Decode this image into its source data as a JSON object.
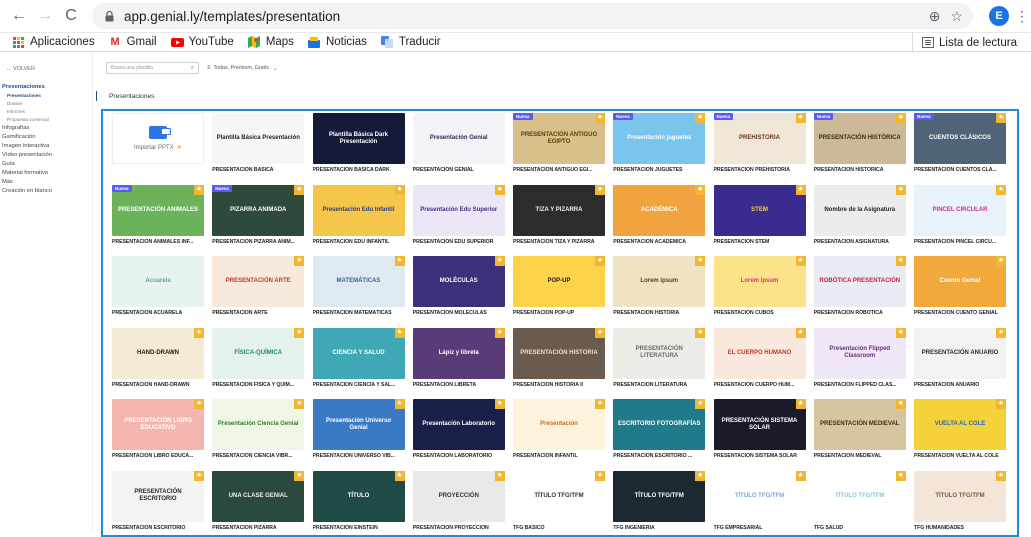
{
  "browser": {
    "url": "app.genial.ly/templates/presentation",
    "avatar_letter": "E",
    "back": "←",
    "forward": "→",
    "reload": "C",
    "zoom_icon": "⊕",
    "star_icon": "☆",
    "menu_icon": "⋮",
    "bookmarks": [
      {
        "label": "Aplicaciones",
        "icon": "apps-grid-icon"
      },
      {
        "label": "Gmail",
        "icon": "gmail-icon",
        "color": "#d93025"
      },
      {
        "label": "YouTube",
        "icon": "youtube-icon",
        "color": "#ff0000"
      },
      {
        "label": "Maps",
        "icon": "maps-icon",
        "color": "#34a853"
      },
      {
        "label": "Noticias",
        "icon": "news-icon",
        "color": "#1a73e8"
      },
      {
        "label": "Traducir",
        "icon": "translate-icon",
        "color": "#4285f4"
      }
    ],
    "reading_list": "Lista de lectura"
  },
  "sidebar": {
    "back_label": "← VOLVER",
    "items": [
      {
        "label": "Presentaciones",
        "type": "item",
        "active": true
      },
      {
        "label": "Presentaciones",
        "type": "sub",
        "active": true
      },
      {
        "label": "Dossier",
        "type": "sub"
      },
      {
        "label": "Informes",
        "type": "sub"
      },
      {
        "label": "Propuesta comercial",
        "type": "sub"
      },
      {
        "label": "Infografías",
        "type": "item"
      },
      {
        "label": "Gamificación",
        "type": "item"
      },
      {
        "label": "Imagen interactiva",
        "type": "item"
      },
      {
        "label": "Vídeo presentación",
        "type": "item"
      },
      {
        "label": "Guía",
        "type": "item"
      },
      {
        "label": "Material formativo",
        "type": "item"
      },
      {
        "label": "Más",
        "type": "item"
      },
      {
        "label": "Creación en blanco",
        "type": "item"
      }
    ]
  },
  "toolbar": {
    "search_placeholder": "Busca una plantilla",
    "filter_label": "Todas, Premium, Gratis"
  },
  "section_title": "Presentaciones",
  "import": {
    "label": "Importar PPTX",
    "star": "★",
    "badge": "BETA"
  },
  "templates": [
    {
      "label": "PRESENTACIÓN BÁSICA",
      "thumb": "Plantilla Básica Presentación",
      "bg": "#f6f6f6",
      "fg": "#222"
    },
    {
      "label": "PRESENTACIÓN BÁSICA DARK",
      "thumb": "Plantilla Básica Dark Presentación",
      "bg": "#161a3a",
      "fg": "#ffffff"
    },
    {
      "label": "PRESENTACIÓN GENIAL",
      "thumb": "Presentación Genial",
      "bg": "#f3f3f7",
      "fg": "#2a2a55"
    },
    {
      "label": "PRESENTACIÓN ANTIGUO EGI...",
      "thumb": "PRESENTACIÓN ANTIGUO EGIPTO",
      "bg": "#d9c08a",
      "fg": "#5a3a10",
      "new": true,
      "star": true
    },
    {
      "label": "PRESENTACIÓN JUGUETES",
      "thumb": "Presentación juguetes",
      "bg": "#7ac5ee",
      "fg": "#ffffff",
      "new": true,
      "star": true
    },
    {
      "label": "PRESENTACIÓN PREHISTORIA",
      "thumb": "PREHISTORIA",
      "bg": "#efe6d8",
      "fg": "#6b3a1e",
      "new": true,
      "star": true
    },
    {
      "label": "PRESENTACIÓN HISTÓRICA",
      "thumb": "PRESENTACIÓN HISTÓRICA",
      "bg": "#cdb897",
      "fg": "#3d2a14",
      "new": true,
      "star": true
    },
    {
      "label": "PRESENTACIÓN CUENTOS CLÁ...",
      "thumb": "CUENTOS CLÁSICOS",
      "bg": "#4f6577",
      "fg": "#ffffff",
      "new": true,
      "star": true
    },
    {
      "label": "PRESENTACIÓN ANIMALES INF...",
      "thumb": "PRESENTACIÓN ANIMALES",
      "bg": "#6bb25a",
      "fg": "#ffffff",
      "new": true,
      "star": true
    },
    {
      "label": "PRESENTACIÓN PIZARRA ANIM...",
      "thumb": "PIZARRA ANIMADA",
      "bg": "#2f4a3a",
      "fg": "#ffffff",
      "new": true,
      "star": true
    },
    {
      "label": "PRESENTACIÓN EDU INFANTIL",
      "thumb": "Presentación Edu Infantil",
      "bg": "#f4c64a",
      "fg": "#2a3c8a",
      "star": true
    },
    {
      "label": "PRESENTACIÓN EDU SUPERIOR",
      "thumb": "Presentación Edu Superior",
      "bg": "#ece6f6",
      "fg": "#4a2a88",
      "star": true
    },
    {
      "label": "PRESENTACIÓN TIZA Y PIZARRA",
      "thumb": "TIZA Y PIZARRA",
      "bg": "#2c2c2c",
      "fg": "#f0f0f0",
      "star": true
    },
    {
      "label": "PRESENTACIÓN ACADÉMICA",
      "thumb": "ACADÉMICA",
      "bg": "#f1a340",
      "fg": "#ffffff",
      "star": true
    },
    {
      "label": "PRESENTACIÓN STEM",
      "thumb": "STEM",
      "bg": "#3a2b8f",
      "fg": "#ffd23f",
      "star": true
    },
    {
      "label": "PRESENTACIÓN ASIGNATURA",
      "thumb": "Nombre de la Asignatura",
      "bg": "#ececec",
      "fg": "#222",
      "star": true
    },
    {
      "label": "PRESENTACIÓN PINCEL CIRCU...",
      "thumb": "PINCEL CIRCULAR",
      "bg": "#e8f2fb",
      "fg": "#d82a8e",
      "star": true
    },
    {
      "label": "PRESENTACIÓN ACUARELA",
      "thumb": "Acuarela",
      "bg": "#e6f3f1",
      "fg": "#6aa0a0"
    },
    {
      "label": "PRESENTACIÓN ARTE",
      "thumb": "PRESENTACIÓN ARTE",
      "bg": "#f7e9dc",
      "fg": "#c23a2a",
      "star": true
    },
    {
      "label": "PRESENTACIÓN MATEMÁTICAS",
      "thumb": "MATEMÁTICAS",
      "bg": "#dfe9f0",
      "fg": "#3a62a0",
      "star": true
    },
    {
      "label": "PRESENTACIÓN MOLÉCULAS",
      "thumb": "MOLÉCULAS",
      "bg": "#3e2f7a",
      "fg": "#ffffff",
      "star": true
    },
    {
      "label": "PRESENTACIÓN POP-UP",
      "thumb": "POP-UP",
      "bg": "#fcd34b",
      "fg": "#1a1a1a",
      "star": true
    },
    {
      "label": "PRESENTACIÓN HISTORIA",
      "thumb": "Lorem ipsum",
      "bg": "#efe3c4",
      "fg": "#5b3a1a",
      "star": true
    },
    {
      "label": "PRESENTACIÓN CUBOS",
      "thumb": "Lorem ipsum",
      "bg": "#fce38a",
      "fg": "#d03a6a",
      "star": true
    },
    {
      "label": "PRESENTACIÓN ROBÓTICA",
      "thumb": "ROBÓTICA PRESENTACIÓN",
      "bg": "#e9ecf2",
      "fg": "#d0203a",
      "star": true
    },
    {
      "label": "PRESENTACIÓN CUENTO GENIAL",
      "thumb": "Cuento Genial",
      "bg": "#f2a93b",
      "fg": "#ffffff",
      "star": true
    },
    {
      "label": "PRESENTACIÓN HAND-DRAWN",
      "thumb": "HAND-DRAWN",
      "bg": "#f4ead6",
      "fg": "#1a1a1a",
      "star": true
    },
    {
      "label": "PRESENTACIÓN FÍSICA Y QUÍM...",
      "thumb": "FÍSICA-QUÍMICA",
      "bg": "#e3f2ec",
      "fg": "#1f8a6a",
      "star": true
    },
    {
      "label": "PRESENTACIÓN CIENCIA Y SAL...",
      "thumb": "CIENCIA Y SALUD",
      "bg": "#3fa7b5",
      "fg": "#ffffff",
      "star": true
    },
    {
      "label": "PRESENTACIÓN LIBRETA",
      "thumb": "Lápiz y libreta",
      "bg": "#5a3b7a",
      "fg": "#ffffff",
      "star": true
    },
    {
      "label": "PRESENTACIÓN HISTORIA II",
      "thumb": "PRESENTACIÓN HISTORIA",
      "bg": "#6b5a4e",
      "fg": "#e8dccb",
      "star": true
    },
    {
      "label": "PRESENTACIÓN LITERATURA",
      "thumb": "PRESENTACIÓN LITERATURA",
      "bg": "#eeece6",
      "fg": "#6a6a6a",
      "star": true
    },
    {
      "label": "PRESENTACIÓN CUERPO HUM...",
      "thumb": "EL CUERPO HUMANO",
      "bg": "#fbe8dc",
      "fg": "#c2361f",
      "star": true
    },
    {
      "label": "PRESENTACIÓN FLIPPED CLAS...",
      "thumb": "Presentación Flipped Classroom",
      "bg": "#f1e8f7",
      "fg": "#6a2a88",
      "star": true
    },
    {
      "label": "PRESENTACIÓN ANUARIO",
      "thumb": "PRESENTACIÓN ANUARIO",
      "bg": "#f2f2f2",
      "fg": "#2a2a2a",
      "star": true
    },
    {
      "label": "PRESENTACIÓN LIBRO EDUCA...",
      "thumb": "PRESENTACIÓN LIBRO EDUCATIVO",
      "bg": "#f6b6b0",
      "fg": "#ffffff",
      "star": true
    },
    {
      "label": "PRESENTACIÓN CIENCIA VIBR...",
      "thumb": "Presentación Ciencia Genial",
      "bg": "#eef7e6",
      "fg": "#3a7a2a",
      "star": true
    },
    {
      "label": "PRESENTACIÓN UNIVERSO VIB...",
      "thumb": "Presentación Universo Genial",
      "bg": "#3a7ac4",
      "fg": "#ffffff",
      "star": true
    },
    {
      "label": "PRESENTACIÓN LABORATORIO",
      "thumb": "Presentación Laboratorio",
      "bg": "#1a1f4a",
      "fg": "#ffffff",
      "star": true
    },
    {
      "label": "PRESENTACIÓN INFANTIL",
      "thumb": "Presentación",
      "bg": "#fdf3dc",
      "fg": "#d06a1a",
      "star": true
    },
    {
      "label": "PRESENTACIÓN ESCRITORIO ...",
      "thumb": "ESCRITORIO FOTOGRAFÍAS",
      "bg": "#1f7a8a",
      "fg": "#ffffff",
      "star": true
    },
    {
      "label": "PRESENTACIÓN SISTEMA SOLAR",
      "thumb": "PRESENTACIÓN SISTEMA SOLAR",
      "bg": "#1a1a2a",
      "fg": "#ffffff",
      "star": true
    },
    {
      "label": "PRESENTACIÓN MEDIEVAL",
      "thumb": "PRESENTACIÓN MEDIEVAL",
      "bg": "#d7c5a2",
      "fg": "#4a2a10",
      "star": true
    },
    {
      "label": "PRESENTACIÓN VUELTA AL COLE",
      "thumb": "VUELTA AL COLE",
      "bg": "#f6d23a",
      "fg": "#2a6ab0",
      "star": true
    },
    {
      "label": "PRESENTACIÓN ESCRITORIO",
      "thumb": "PRESENTACIÓN ESCRITORIO",
      "bg": "#f3f3f3",
      "fg": "#2a2a2a",
      "star": true
    },
    {
      "label": "PRESENTACIÓN PIZARRA",
      "thumb": "UNA CLASE GENIAL",
      "bg": "#2b4a3f",
      "fg": "#f0f0f0",
      "star": true
    },
    {
      "label": "PRESENTACIÓN EINSTEIN",
      "thumb": "TÍTULO",
      "bg": "#1f4a45",
      "fg": "#ffffff",
      "star": true
    },
    {
      "label": "PRESENTACIÓN PROYECCIÓN",
      "thumb": "PROYECCIÓN",
      "bg": "#e9e9e9",
      "fg": "#333",
      "star": true
    },
    {
      "label": "TFG BÁSICO",
      "thumb": "TÍTULO TFG/TFM",
      "bg": "#ffffff",
      "fg": "#333",
      "star": true
    },
    {
      "label": "TFG INGENIERÍA",
      "thumb": "TÍTULO TFG/TFM",
      "bg": "#1b2a30",
      "fg": "#ffffff",
      "star": true
    },
    {
      "label": "TFG EMPRESARIAL",
      "thumb": "TÍTULO TFG/TFM",
      "bg": "#ffffff",
      "fg": "#7aa6d6",
      "star": true
    },
    {
      "label": "TFG SALUD",
      "thumb": "TÍTULO TFG/TFM",
      "bg": "#ffffff",
      "fg": "#8ac6d6",
      "star": true
    },
    {
      "label": "TFG HUMANIDADES",
      "thumb": "TÍTULO TFG/TFM",
      "bg": "#f3e6d8",
      "fg": "#7a5a3a",
      "star": true
    }
  ],
  "badges": {
    "new": "Nueva",
    "star": "★"
  }
}
